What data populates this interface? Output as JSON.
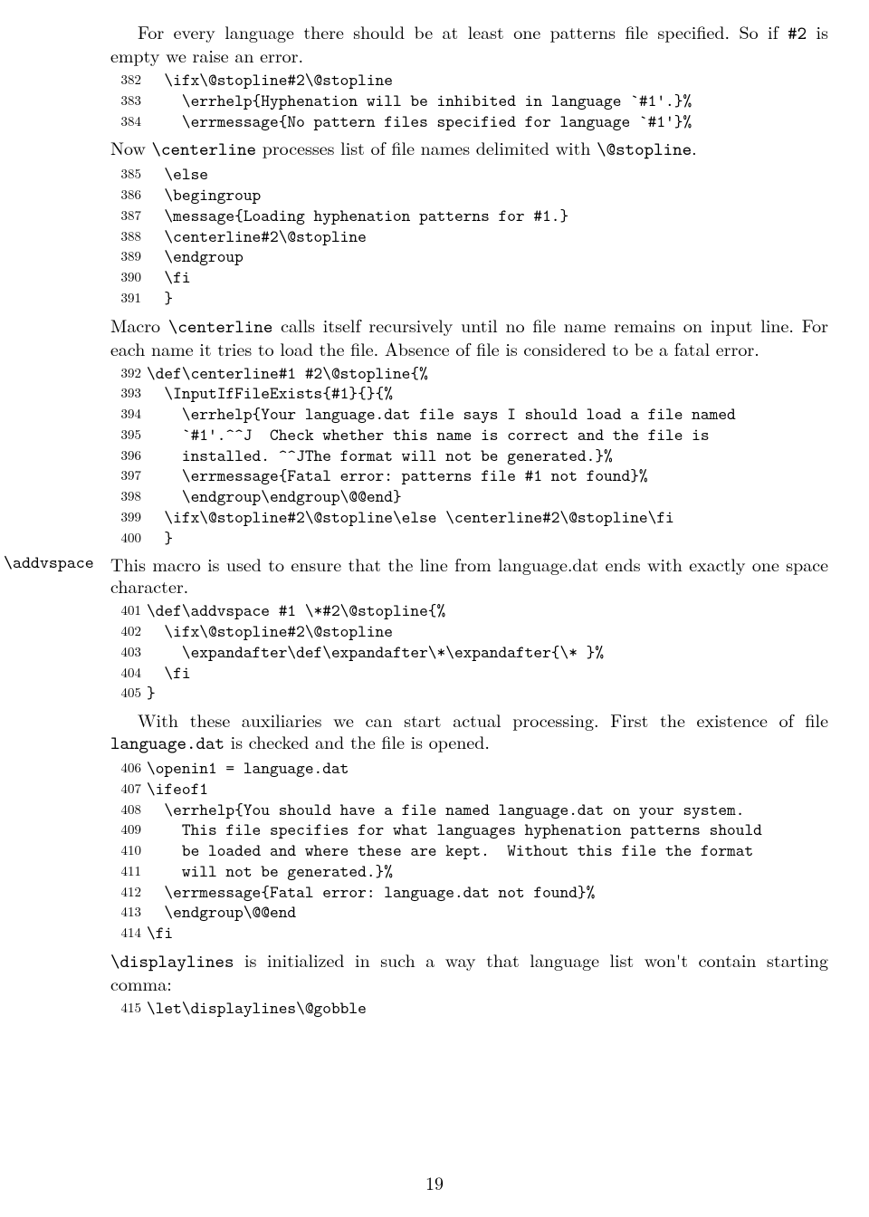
{
  "page_number": "19",
  "sections": [
    {
      "type": "para",
      "indent": true,
      "runs": [
        {
          "t": "For every language there should be at least one patterns file specified. So if ",
          "cls": "rm"
        },
        {
          "t": "#2",
          "cls": "tt"
        },
        {
          "t": " is empty we raise an error.",
          "cls": "rm"
        }
      ]
    },
    {
      "type": "code",
      "lines": [
        {
          "n": "382",
          "t": "  \\ifx\\@stopline#2\\@stopline"
        },
        {
          "n": "383",
          "t": "    \\errhelp{Hyphenation will be inhibited in language `#1'.}%"
        },
        {
          "n": "384",
          "t": "    \\errmessage{No pattern files specified for language `#1'}%"
        }
      ]
    },
    {
      "type": "para",
      "runs": [
        {
          "t": "Now ",
          "cls": "rm"
        },
        {
          "t": "\\centerline",
          "cls": "tt"
        },
        {
          "t": " processes list of file names delimited with ",
          "cls": "rm"
        },
        {
          "t": "\\@stopline",
          "cls": "tt"
        },
        {
          "t": ".",
          "cls": "rm"
        }
      ]
    },
    {
      "type": "code",
      "lines": [
        {
          "n": "385",
          "t": "  \\else"
        },
        {
          "n": "386",
          "t": "  \\begingroup"
        },
        {
          "n": "387",
          "t": "  \\message{Loading hyphenation patterns for #1.}"
        },
        {
          "n": "388",
          "t": "  \\centerline#2\\@stopline"
        },
        {
          "n": "389",
          "t": "  \\endgroup"
        },
        {
          "n": "390",
          "t": "  \\fi"
        },
        {
          "n": "391",
          "t": "  }"
        }
      ]
    },
    {
      "type": "para",
      "runs": [
        {
          "t": "Macro ",
          "cls": "rm"
        },
        {
          "t": "\\centerline",
          "cls": "tt"
        },
        {
          "t": " calls itself recursively until no file name remains on input line. For each name it tries to load the file. Absence of file is considered to be a fatal error.",
          "cls": "rm"
        }
      ]
    },
    {
      "type": "code",
      "lines": [
        {
          "n": "392",
          "t": "\\def\\centerline#1 #2\\@stopline{%"
        },
        {
          "n": "393",
          "t": "  \\InputIfFileExists{#1}{}{%"
        },
        {
          "n": "394",
          "t": "    \\errhelp{Your language.dat file says I should load a file named"
        },
        {
          "n": "395",
          "t": "    `#1'.^^J  Check whether this name is correct and the file is"
        },
        {
          "n": "396",
          "t": "    installed. ^^JThe format will not be generated.}%"
        },
        {
          "n": "397",
          "t": "    \\errmessage{Fatal error: patterns file #1 not found}%"
        },
        {
          "n": "398",
          "t": "    \\endgroup\\endgroup\\@@end}"
        },
        {
          "n": "399",
          "t": "  \\ifx\\@stopline#2\\@stopline\\else \\centerline#2\\@stopline\\fi"
        },
        {
          "n": "400",
          "t": "  }"
        }
      ]
    },
    {
      "type": "para",
      "margin_label": "\\addvspace",
      "runs": [
        {
          "t": "This macro is used to ensure that the line from language.dat ends with exactly one space character.",
          "cls": "rm"
        }
      ]
    },
    {
      "type": "code",
      "lines": [
        {
          "n": "401",
          "t": "\\def\\addvspace #1 \\*#2\\@stopline{%"
        },
        {
          "n": "402",
          "t": "  \\ifx\\@stopline#2\\@stopline"
        },
        {
          "n": "403",
          "t": "    \\expandafter\\def\\expandafter\\*\\expandafter{\\* }%"
        },
        {
          "n": "404",
          "t": "  \\fi"
        },
        {
          "n": "405",
          "t": "}"
        }
      ]
    },
    {
      "type": "para",
      "indent": true,
      "runs": [
        {
          "t": "With these auxiliaries we can start actual processing. First the existence of file ",
          "cls": "rm"
        },
        {
          "t": "language.dat",
          "cls": "tt"
        },
        {
          "t": " is checked and the file is opened.",
          "cls": "rm"
        }
      ]
    },
    {
      "type": "code",
      "lines": [
        {
          "n": "406",
          "t": "\\openin1 = language.dat"
        },
        {
          "n": "407",
          "t": "\\ifeof1"
        },
        {
          "n": "408",
          "t": "  \\errhelp{You should have a file named language.dat on your system."
        },
        {
          "n": "409",
          "t": "    This file specifies for what languages hyphenation patterns should"
        },
        {
          "n": "410",
          "t": "    be loaded and where these are kept.  Without this file the format"
        },
        {
          "n": "411",
          "t": "    will not be generated.}%"
        },
        {
          "n": "412",
          "t": "  \\errmessage{Fatal error: language.dat not found}%"
        },
        {
          "n": "413",
          "t": "  \\endgroup\\@@end"
        },
        {
          "n": "414",
          "t": "\\fi"
        }
      ]
    },
    {
      "type": "para",
      "runs": [
        {
          "t": "\\displaylines",
          "cls": "tt"
        },
        {
          "t": " is initialized in such a way that language list won't contain starting comma:",
          "cls": "rm"
        }
      ]
    },
    {
      "type": "code",
      "lines": [
        {
          "n": "415",
          "t": "\\let\\displaylines\\@gobble"
        }
      ]
    }
  ]
}
